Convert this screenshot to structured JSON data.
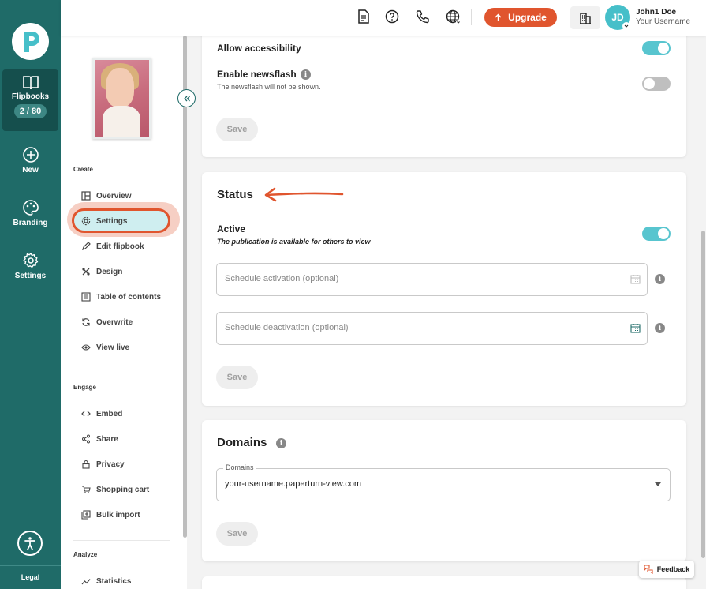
{
  "rail": {
    "items": [
      {
        "label": "Flipbooks",
        "badge": "2 / 80"
      },
      {
        "label": "New"
      },
      {
        "label": "Branding"
      },
      {
        "label": "Settings"
      }
    ],
    "legal": "Legal"
  },
  "topbar": {
    "upgrade": "Upgrade",
    "avatar_initials": "JD",
    "user_name": "John1 Doe",
    "user_handle": "Your Username"
  },
  "sidebar": {
    "create_heading": "Create",
    "create_items": [
      "Overview",
      "Settings",
      "Edit flipbook",
      "Design",
      "Table of contents",
      "Overwrite",
      "View live"
    ],
    "engage_heading": "Engage",
    "engage_items": [
      "Embed",
      "Share",
      "Privacy",
      "Shopping cart",
      "Bulk import"
    ],
    "analyze_heading": "Analyze",
    "analyze_items": [
      "Statistics"
    ],
    "active_item": "Settings"
  },
  "general_card": {
    "allow_accessibility": "Allow accessibility",
    "allow_accessibility_on": true,
    "enable_newsflash": "Enable newsflash",
    "newsflash_hint": "The newsflash will not be shown.",
    "enable_newsflash_on": false,
    "save": "Save"
  },
  "status_card": {
    "title": "Status",
    "active_label": "Active",
    "active_hint": "The publication is available for others to view",
    "active_on": true,
    "activation_placeholder": "Schedule activation (optional)",
    "deactivation_placeholder": "Schedule deactivation (optional)",
    "save": "Save"
  },
  "domains_card": {
    "title": "Domains",
    "field_label": "Domains",
    "selected_value": "your-username.paperturn-view.com",
    "save": "Save"
  },
  "feedback": "Feedback",
  "colors": {
    "rail": "#1f6b68",
    "accent": "#e0552e",
    "toggle_on": "#58c5cf"
  }
}
